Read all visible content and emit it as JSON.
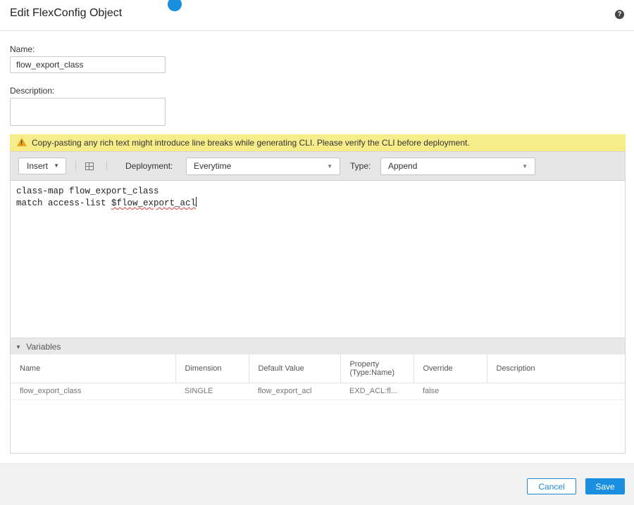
{
  "header": {
    "title": "Edit FlexConfig Object",
    "help_glyph": "?"
  },
  "form": {
    "name_label": "Name:",
    "name_value": "flow_export_class",
    "description_label": "Description:",
    "description_value": ""
  },
  "warning": {
    "text": "Copy-pasting any rich text might introduce line breaks while generating CLI. Please verify the CLI before deployment."
  },
  "toolbar": {
    "insert_label": "Insert",
    "deployment_label": "Deployment:",
    "deployment_value": "Everytime",
    "type_label": "Type:",
    "type_value": "Append"
  },
  "editor": {
    "line1": "class-map flow_export_class",
    "line2_prefix": "match access-list ",
    "line2_variable": "$flow_export_acl"
  },
  "variables": {
    "section_label": "Variables",
    "columns": [
      "Name",
      "Dimension",
      "Default Value",
      "Property (Type:Name)",
      "Override",
      "Description"
    ],
    "rows": [
      {
        "name": "flow_export_class",
        "dimension": "SINGLE",
        "default_value": "flow_export_acl",
        "property": "EXD_ACL:fl...",
        "override": "false",
        "description": ""
      }
    ]
  },
  "footer": {
    "cancel_label": "Cancel",
    "save_label": "Save"
  },
  "colors": {
    "primary": "#1a8fe0",
    "warning_bg": "#f6ec8a",
    "warning_icon": "#e8a317",
    "spellcheck": "#e23b3b"
  },
  "icons": {
    "help": "help-icon",
    "warning": "warning-icon",
    "insert_caret": "chevron-down-icon",
    "table": "table-icon",
    "collapse": "triangle-down-icon"
  }
}
